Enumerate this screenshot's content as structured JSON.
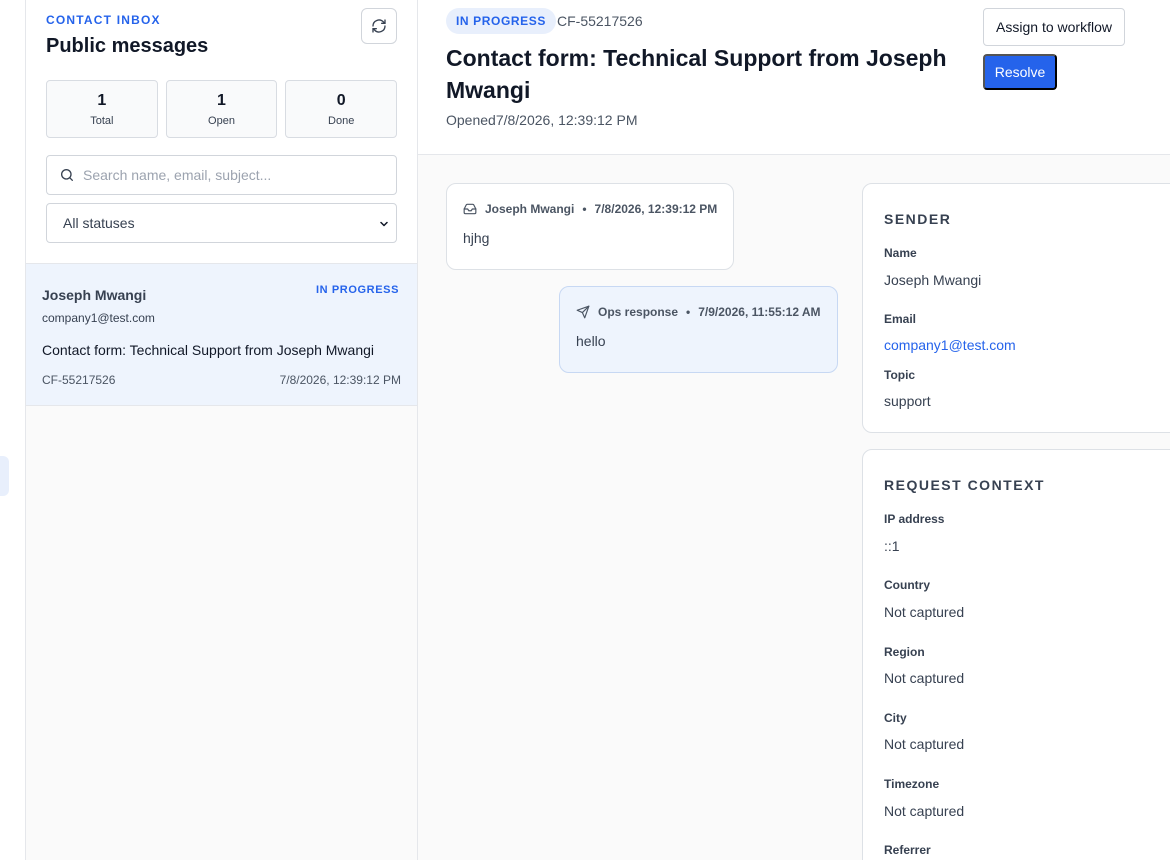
{
  "sidebar": {
    "eyebrow": "CONTACT INBOX",
    "title": "Public messages",
    "stats": [
      {
        "value": "1",
        "label": "Total"
      },
      {
        "value": "1",
        "label": "Open"
      },
      {
        "value": "0",
        "label": "Done"
      }
    ],
    "search_placeholder": "Search name, email, subject...",
    "status_filter": "All statuses",
    "messages": [
      {
        "name": "Joseph Mwangi",
        "status": "IN PROGRESS",
        "email": "company1@test.com",
        "subject": "Contact form: Technical Support from Joseph Mwangi",
        "ref": "CF-55217526",
        "date": "7/8/2026, 12:39:12 PM"
      }
    ]
  },
  "detail": {
    "status": "IN PROGRESS",
    "ref": "CF-55217526",
    "title": "Contact form: Technical Support from Joseph Mwangi",
    "opened": "Opened7/8/2026, 12:39:12 PM",
    "assign_label": "Assign to workflow",
    "resolve_label": "Resolve",
    "thread": [
      {
        "author": "Joseph Mwangi",
        "date": "7/8/2026, 12:39:12 PM",
        "text": "hjhg",
        "icon": "inbox-icon"
      },
      {
        "author": "Ops response",
        "date": "7/9/2026, 11:55:12 AM",
        "text": "hello",
        "icon": "send-icon"
      }
    ],
    "sender": {
      "heading": "SENDER",
      "fields": [
        {
          "label": "Name",
          "value": "Joseph Mwangi"
        },
        {
          "label": "Email",
          "value": "company1@test.com"
        },
        {
          "label": "Topic",
          "value": "support"
        }
      ]
    },
    "context": {
      "heading": "REQUEST CONTEXT",
      "fields": [
        {
          "label": "IP address",
          "value": "::1"
        },
        {
          "label": "Country",
          "value": "Not captured"
        },
        {
          "label": "Region",
          "value": "Not captured"
        },
        {
          "label": "City",
          "value": "Not captured"
        },
        {
          "label": "Timezone",
          "value": "Not captured"
        },
        {
          "label": "Referrer",
          "value": ""
        }
      ]
    }
  },
  "colors": {
    "accent": "#2563eb",
    "selected_bg": "#eef4fd",
    "pill_bg": "#e8effc"
  }
}
